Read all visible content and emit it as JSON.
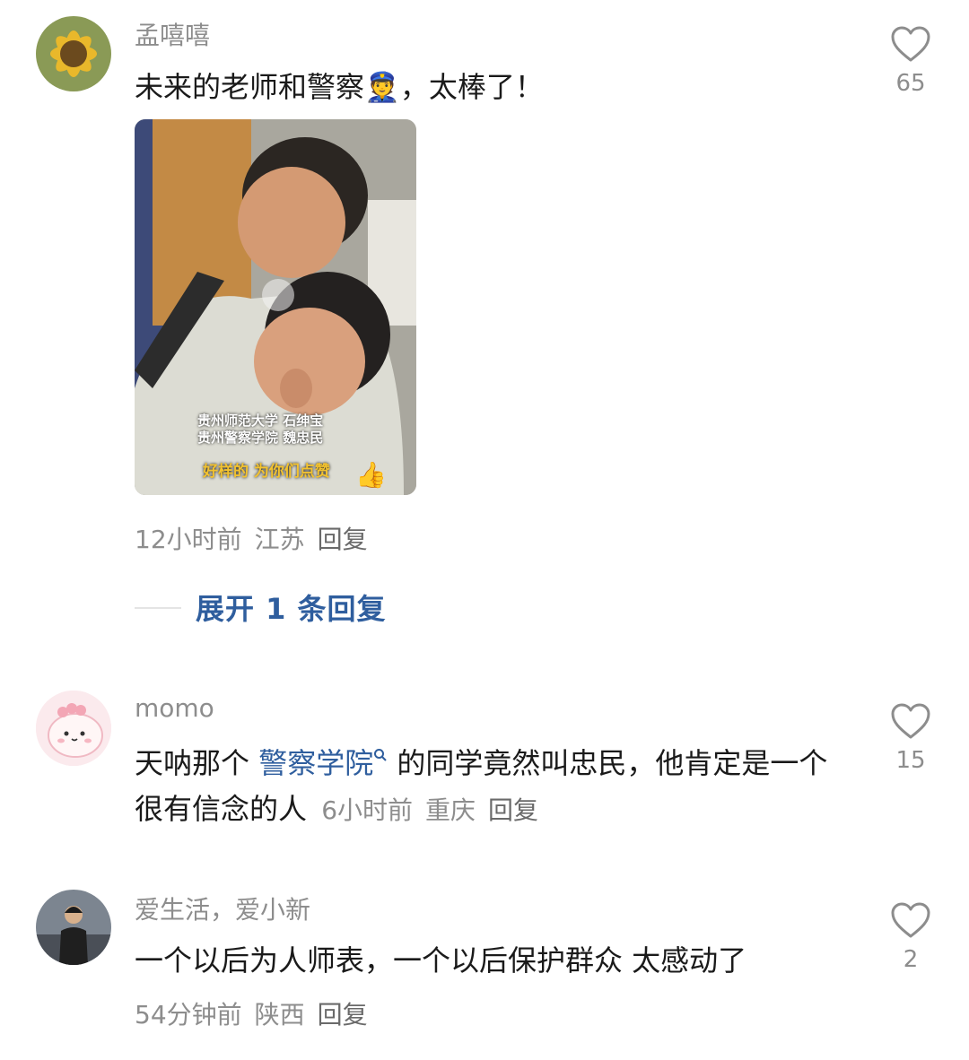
{
  "comments": [
    {
      "username": "孟嘻嘻",
      "text": "未来的老师和警察👮，太棒了！",
      "image": {
        "caption_lines": [
          "贵州师范大学 石绅宝",
          "贵州警察学院 魏忠民"
        ],
        "caption_highlight": "好样的 为你们点赞"
      },
      "time": "12小时前",
      "location": "江苏",
      "reply_label": "回复",
      "likes": "65",
      "expand_label": "展开 1 条回复"
    },
    {
      "username": "momo",
      "text_before": "天呐那个 ",
      "link_text": "警察学院",
      "text_after": " 的同学竟然叫忠民，他肯定是一个很有信念的人",
      "time": "6小时前",
      "location": "重庆",
      "reply_label": "回复",
      "likes": "15"
    },
    {
      "username": "爱生活，爱小新",
      "text": "一个以后为人师表，一个以后保护群众 太感动了",
      "time": "54分钟前",
      "location": "陕西",
      "reply_label": "回复",
      "likes": "2"
    }
  ],
  "colors": {
    "username": "#8d8d8d",
    "link": "#2f5e9e",
    "caption_yellow": "#f2c230"
  },
  "icons": {
    "like": "heart-outline-icon",
    "search_hint": "search-icon"
  }
}
